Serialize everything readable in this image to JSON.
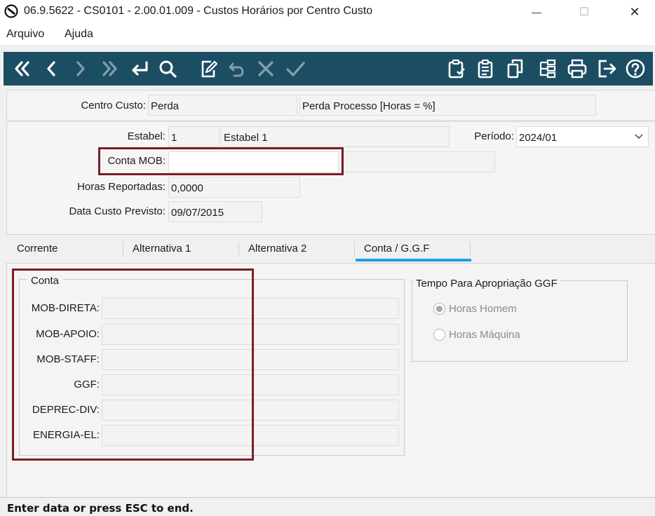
{
  "window": {
    "title": "06.9.5622 - CS0101 - 2.00.01.009 - Custos Horários por Centro Custo",
    "minimize_glyph": "—",
    "maximize_glyph": "☐",
    "close_glyph": "✕"
  },
  "menu": {
    "items": [
      "Arquivo",
      "Ajuda"
    ]
  },
  "toolbar": {
    "icons": [
      "first-icon",
      "previous-icon",
      "next-icon",
      "last-icon",
      "return-icon",
      "search-icon",
      "edit-icon",
      "undo-icon",
      "cancel-icon",
      "confirm-icon",
      "clipboard-check-icon",
      "clipboard-list-icon",
      "copy-icon",
      "tree-icon",
      "print-icon",
      "exit-icon",
      "help-icon"
    ],
    "bg_color": "#1c4e63",
    "icon_color": "#ffffff"
  },
  "header": {
    "centro_custo_label": "Centro Custo:",
    "centro_custo_value": "Perda",
    "centro_custo_desc": "Perda  Processo  [Horas = %]"
  },
  "form": {
    "estabel_label": "Estabel:",
    "estabel_value": "1",
    "estabel_desc": "Estabel 1",
    "periodo_label": "Período:",
    "periodo_value": "2024/01",
    "conta_mob_label": "Conta MOB:",
    "conta_mob_value": "",
    "conta_mob_desc": "",
    "horas_label": "Horas Reportadas:",
    "horas_value": "0,0000",
    "data_label": "Data Custo Previsto:",
    "data_value": "09/07/2015"
  },
  "tabs": [
    {
      "label": "Corrente",
      "active": false
    },
    {
      "label": "Alternativa 1",
      "active": false
    },
    {
      "label": "Alternativa 2",
      "active": false
    },
    {
      "label": "Conta / G.G.F",
      "active": true
    }
  ],
  "conta_group": {
    "title": "Conta",
    "fields": [
      {
        "label": "MOB-DIRETA:",
        "value": ""
      },
      {
        "label": "MOB-APOIO:",
        "value": ""
      },
      {
        "label": "MOB-STAFF:",
        "value": ""
      },
      {
        "label": "GGF:",
        "value": ""
      },
      {
        "label": "DEPREC-DIV:",
        "value": ""
      },
      {
        "label": "ENERGIA-EL:",
        "value": ""
      }
    ]
  },
  "ggf_group": {
    "title": "Tempo Para Apropriação GGF",
    "options": [
      {
        "label": "Horas Homem",
        "selected": true
      },
      {
        "label": "Horas Máquina",
        "selected": false
      }
    ]
  },
  "status": {
    "text": "Enter data or press ESC to end."
  },
  "colors": {
    "accent_tab": "#1aa3e0",
    "highlight_box": "#7a1d24"
  }
}
